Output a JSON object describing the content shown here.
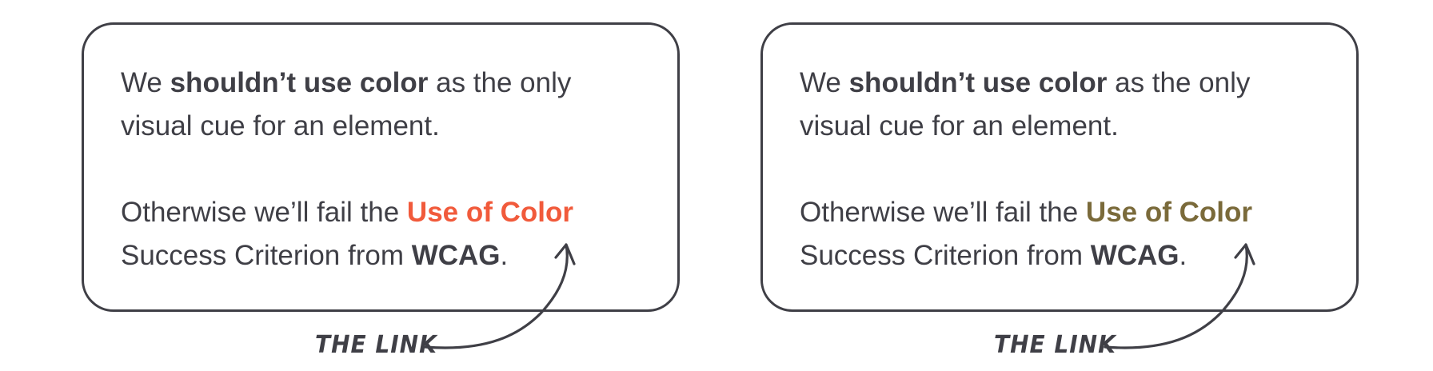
{
  "colors": {
    "text": "#3f3f46",
    "border": "#3f3f46",
    "link_failing": "#f15a3b",
    "link_passing": "#7a6a3a",
    "background": "#ffffff"
  },
  "panels": [
    {
      "line1_a": "We ",
      "line1_bold": "shouldn’t use color",
      "line1_b": " as the only",
      "line2": "visual cue for an element.",
      "line3_a": "Otherwise we’ll fail the ",
      "line3_link": "Use of Color",
      "line4_a": "Success Criterion from ",
      "line4_bold": "WCAG",
      "line4_b": ".",
      "link_color": "#f15a3b",
      "annotation": "THE LINK",
      "arrow_icon": "curved-arrow-icon"
    },
    {
      "line1_a": "We ",
      "line1_bold": "shouldn’t use color",
      "line1_b": " as the only",
      "line2": "visual cue for an element.",
      "line3_a": "Otherwise we’ll fail the ",
      "line3_link": "Use of Color",
      "line4_a": "Success Criterion from ",
      "line4_bold": "WCAG",
      "line4_b": ".",
      "link_color": "#7a6a3a",
      "annotation": "THE LINK",
      "arrow_icon": "curved-arrow-icon"
    }
  ]
}
